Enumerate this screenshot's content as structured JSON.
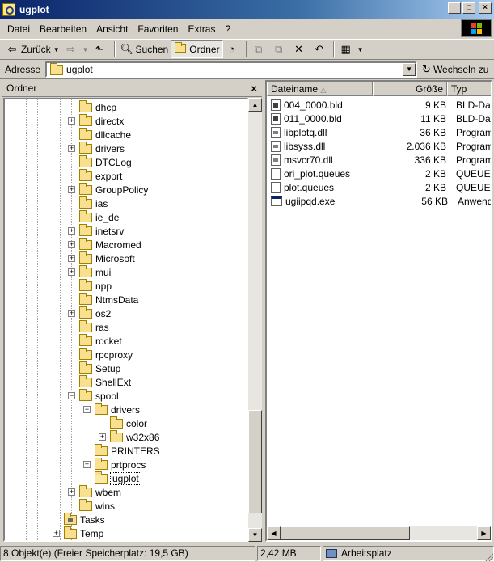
{
  "window": {
    "title": "ugplot"
  },
  "menu": [
    "Datei",
    "Bearbeiten",
    "Ansicht",
    "Favoriten",
    "Extras",
    "?"
  ],
  "toolbar": {
    "back_label": "Zurück",
    "search_label": "Suchen",
    "folders_label": "Ordner"
  },
  "address": {
    "label": "Adresse",
    "value": "ugplot",
    "go_label": "Wechseln zu"
  },
  "folder_pane": {
    "title": "Ordner",
    "close": "×",
    "items": [
      {
        "label": "dhcp"
      },
      {
        "label": "directx"
      },
      {
        "label": "dllcache"
      },
      {
        "label": "drivers"
      },
      {
        "label": "DTCLog"
      },
      {
        "label": "export"
      },
      {
        "label": "GroupPolicy"
      },
      {
        "label": "ias"
      },
      {
        "label": "ie_de"
      },
      {
        "label": "inetsrv"
      },
      {
        "label": "Macromed"
      },
      {
        "label": "Microsoft"
      },
      {
        "label": "mui"
      },
      {
        "label": "npp"
      },
      {
        "label": "NtmsData"
      },
      {
        "label": "os2"
      },
      {
        "label": "ras"
      },
      {
        "label": "rocket"
      },
      {
        "label": "rpcproxy"
      },
      {
        "label": "Setup"
      },
      {
        "label": "ShellExt"
      },
      {
        "label": "spool"
      },
      {
        "label": "drivers"
      },
      {
        "label": "color"
      },
      {
        "label": "w32x86"
      },
      {
        "label": "PRINTERS"
      },
      {
        "label": "prtprocs"
      },
      {
        "label": "ugplot"
      },
      {
        "label": "wbem"
      },
      {
        "label": "wins"
      },
      {
        "label": "Tasks"
      },
      {
        "label": "Temp"
      }
    ]
  },
  "file_list": {
    "columns": {
      "name": "Dateiname",
      "size": "Größe",
      "type": "Typ"
    },
    "rows": [
      {
        "name": "004_0000.bld",
        "size": "9 KB",
        "type": "BLD-Datei",
        "icon": "bld-file-icon"
      },
      {
        "name": "011_0000.bld",
        "size": "11 KB",
        "type": "BLD-Datei",
        "icon": "bld-file-icon"
      },
      {
        "name": "libplotq.dll",
        "size": "36 KB",
        "type": "Programmbibliothek",
        "icon": "dll-file-icon"
      },
      {
        "name": "libsyss.dll",
        "size": "2.036 KB",
        "type": "Programmbibliothek",
        "icon": "dll-file-icon"
      },
      {
        "name": "msvcr70.dll",
        "size": "336 KB",
        "type": "Programmbibliothek",
        "icon": "dll-file-icon"
      },
      {
        "name": "ori_plot.queues",
        "size": "2 KB",
        "type": "QUEUES-Datei",
        "icon": "generic-file-icon"
      },
      {
        "name": "plot.queues",
        "size": "2 KB",
        "type": "QUEUES-Datei",
        "icon": "generic-file-icon"
      },
      {
        "name": "ugiipqd.exe",
        "size": "56 KB",
        "type": "Anwendung",
        "icon": "exe-file-icon"
      }
    ]
  },
  "status": {
    "objects": "8 Objekt(e) (Freier Speicherplatz: 19,5 GB)",
    "size": "2,42 MB",
    "zone": "Arbeitsplatz"
  }
}
